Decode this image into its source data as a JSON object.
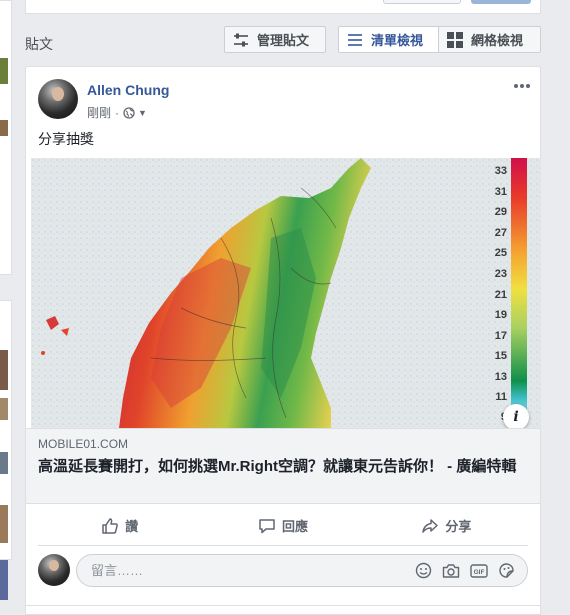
{
  "posts_header": {
    "title": "貼文",
    "manage_label": "管理貼文",
    "list_view_label": "清單檢視",
    "grid_view_label": "網格檢視"
  },
  "post": {
    "author": "Allen Chung",
    "timestamp": "剛剛",
    "text": "分享抽獎",
    "link": {
      "domain": "MOBILE01.COM",
      "title": "高溫延長賽開打，如何挑選Mr.Right空調？就讓東元告訴你！ - 廣編特輯"
    },
    "legend_values": [
      "33",
      "31",
      "29",
      "27",
      "25",
      "23",
      "21",
      "19",
      "17",
      "15",
      "13",
      "11",
      "9"
    ],
    "actions": {
      "like_label": "讚",
      "comment_label": "回應",
      "share_label": "分享"
    },
    "comment_placeholder": "留言……"
  },
  "icons": {
    "more": "more-icon",
    "globe": "globe-icon",
    "info": "info-icon",
    "like": "thumbs-up-icon",
    "comment": "comment-icon",
    "share": "share-icon",
    "emoji": "emoji-icon",
    "camera": "camera-icon",
    "gif": "gif-icon",
    "sticker": "sticker-icon"
  },
  "colors": {
    "link_blue": "#365899",
    "page_bg": "#e9ebee"
  }
}
